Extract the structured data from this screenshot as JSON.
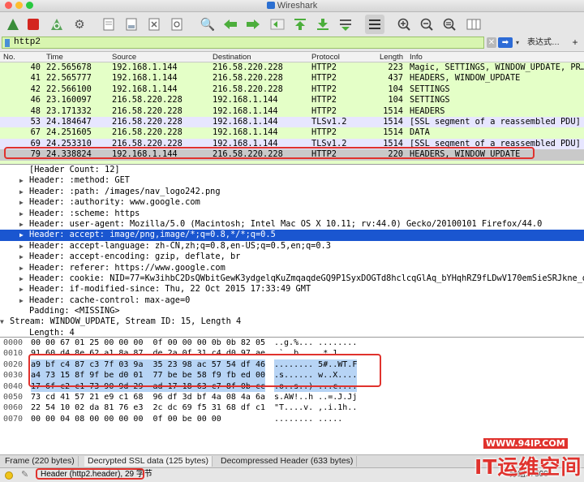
{
  "window": {
    "title": "Wireshark"
  },
  "filter": {
    "value": "http2",
    "expression_label": "表达式…"
  },
  "packet_list": {
    "columns": [
      "No.",
      "Time",
      "Source",
      "Destination",
      "Protocol",
      "Length",
      "Info"
    ],
    "rows": [
      {
        "no": "40",
        "time": "22.565678",
        "src": "192.168.1.144",
        "dst": "216.58.220.228",
        "proto": "HTTP2",
        "len": "223",
        "info": "Magic, SETTINGS, WINDOW_UPDATE, PR…",
        "bg": "#e4ffc7"
      },
      {
        "no": "41",
        "time": "22.565777",
        "src": "192.168.1.144",
        "dst": "216.58.220.228",
        "proto": "HTTP2",
        "len": "437",
        "info": "HEADERS, WINDOW_UPDATE",
        "bg": "#e4ffc7"
      },
      {
        "no": "42",
        "time": "22.566100",
        "src": "192.168.1.144",
        "dst": "216.58.220.228",
        "proto": "HTTP2",
        "len": "104",
        "info": "SETTINGS",
        "bg": "#e4ffc7"
      },
      {
        "no": "46",
        "time": "23.160097",
        "src": "216.58.220.228",
        "dst": "192.168.1.144",
        "proto": "HTTP2",
        "len": "104",
        "info": "SETTINGS",
        "bg": "#e4ffc7"
      },
      {
        "no": "48",
        "time": "23.171332",
        "src": "216.58.220.228",
        "dst": "192.168.1.144",
        "proto": "HTTP2",
        "len": "1514",
        "info": "HEADERS",
        "bg": "#e4ffc7"
      },
      {
        "no": "53",
        "time": "24.184647",
        "src": "216.58.220.228",
        "dst": "192.168.1.144",
        "proto": "TLSv1.2",
        "len": "1514",
        "info": "[SSL segment of a reassembled PDU]",
        "bg": "#e7e6ff"
      },
      {
        "no": "67",
        "time": "24.251605",
        "src": "216.58.220.228",
        "dst": "192.168.1.144",
        "proto": "HTTP2",
        "len": "1514",
        "info": "DATA",
        "bg": "#e4ffc7"
      },
      {
        "no": "69",
        "time": "24.253310",
        "src": "216.58.220.228",
        "dst": "192.168.1.144",
        "proto": "TLSv1.2",
        "len": "1514",
        "info": "[SSL segment of a reassembled PDU]",
        "bg": "#e7e6ff"
      },
      {
        "no": "79",
        "time": "24.338824",
        "src": "192.168.1.144",
        "dst": "216.58.220.228",
        "proto": "HTTP2",
        "len": "220",
        "info": "HEADERS, WINDOW_UPDATE",
        "bg": "#c9c9c9"
      }
    ]
  },
  "details": [
    {
      "indent": 3,
      "arrow": "",
      "text": "[Header Count: 12]"
    },
    {
      "indent": 3,
      "arrow": "▶",
      "text": "Header: :method: GET"
    },
    {
      "indent": 3,
      "arrow": "▶",
      "text": "Header: :path: /images/nav_logo242.png"
    },
    {
      "indent": 3,
      "arrow": "▶",
      "text": "Header: :authority: www.google.com"
    },
    {
      "indent": 3,
      "arrow": "▶",
      "text": "Header: :scheme: https"
    },
    {
      "indent": 3,
      "arrow": "▶",
      "text": "Header: user-agent: Mozilla/5.0 (Macintosh; Intel Mac OS X 10.11; rv:44.0) Gecko/20100101 Firefox/44.0"
    },
    {
      "indent": 3,
      "arrow": "▶",
      "text": "Header: accept: image/png,image/*;q=0.8,*/*;q=0.5",
      "selected": true
    },
    {
      "indent": 3,
      "arrow": "▶",
      "text": "Header: accept-language: zh-CN,zh;q=0.8,en-US;q=0.5,en;q=0.3"
    },
    {
      "indent": 3,
      "arrow": "▶",
      "text": "Header: accept-encoding: gzip, deflate, br"
    },
    {
      "indent": 3,
      "arrow": "▶",
      "text": "Header: referer: https://www.google.com"
    },
    {
      "indent": 3,
      "arrow": "▶",
      "text": "Header: cookie: NID=77=Kw3ihbC2DsQWbitGewK3ydgelqKuZmqaqdeGQ9P1SyxDOGTd8hclcqGlAq_bYHqhRZ9fLDwV170emSieSRJkne_dnRle"
    },
    {
      "indent": 3,
      "arrow": "▶",
      "text": "Header: if-modified-since: Thu, 22 Oct 2015 17:33:49 GMT"
    },
    {
      "indent": 3,
      "arrow": "▶",
      "text": "Header: cache-control: max-age=0"
    },
    {
      "indent": 3,
      "arrow": "",
      "text": "Padding: <MISSING>"
    },
    {
      "indent": 1,
      "arrow": "▼",
      "text": "Stream: WINDOW_UPDATE, Stream ID: 15, Length 4"
    },
    {
      "indent": 3,
      "arrow": "",
      "text": "Length: 4"
    }
  ],
  "hex": [
    {
      "off": "0000",
      "bytes": "00 00 67 01 25 00 00 00  0f 00 00 00 0b 0b 82 05",
      "ascii": "..g.%... ........",
      "sel": false
    },
    {
      "off": "0010",
      "bytes": "91 60 d4 8e 62 a1 8a 87  de 2a 0f 31 c4 d0 97 ae",
      "ascii": ".`..b... .*.1....",
      "sel": false
    },
    {
      "off": "0020",
      "bytes": "a9 bf c4 87 c3 7f 03 9a  35 23 98 ac 57 54 df 46",
      "ascii": "........ 5#..WT.F",
      "sel": true
    },
    {
      "off": "0030",
      "bytes": "a4 73 15 8f 9f be d0 01  77 be be 58 f9 fb ed 00",
      "ascii": ".s...... w..X....",
      "sel": true
    },
    {
      "off": "0040",
      "bytes": "17 6f c2 c1 73 90 9d 29  ad 17 18 63 c7 8f 0b cc",
      "ascii": ".o..s..) ...c....",
      "sel": true
    },
    {
      "off": "0050",
      "bytes": "73 cd 41 57 21 e9 c1 68  96 df 3d bf 4a 08 4a 6a",
      "ascii": "s.AW!..h ..=.J.Jj",
      "sel": false
    },
    {
      "off": "0060",
      "bytes": "22 54 10 02 da 81 76 e3  2c dc 69 f5 31 68 df c1",
      "ascii": "\"T....v. ,.i.1h..",
      "sel": false
    },
    {
      "off": "0070",
      "bytes": "00 00 04 08 00 00 00 00  0f 00 be 00 00",
      "ascii": "........ .....",
      "sel": false
    }
  ],
  "bottom_tabs": [
    "Frame (220 bytes)",
    "Decrypted SSL data (125 bytes)",
    "Decompressed Header (633 bytes)"
  ],
  "status": {
    "field": "Header (http2.header), 29 字节",
    "packets": "分组: 7500"
  },
  "watermark": {
    "url": "WWW.94IP.COM",
    "brand": "IT运维空间"
  },
  "colors": {
    "http2_row": "#e4ffc7",
    "tls_row": "#e7e6ff",
    "selected_row": "#c9c9c9",
    "selection_blue": "#1a56d0",
    "highlight_red": "#e0322d"
  }
}
